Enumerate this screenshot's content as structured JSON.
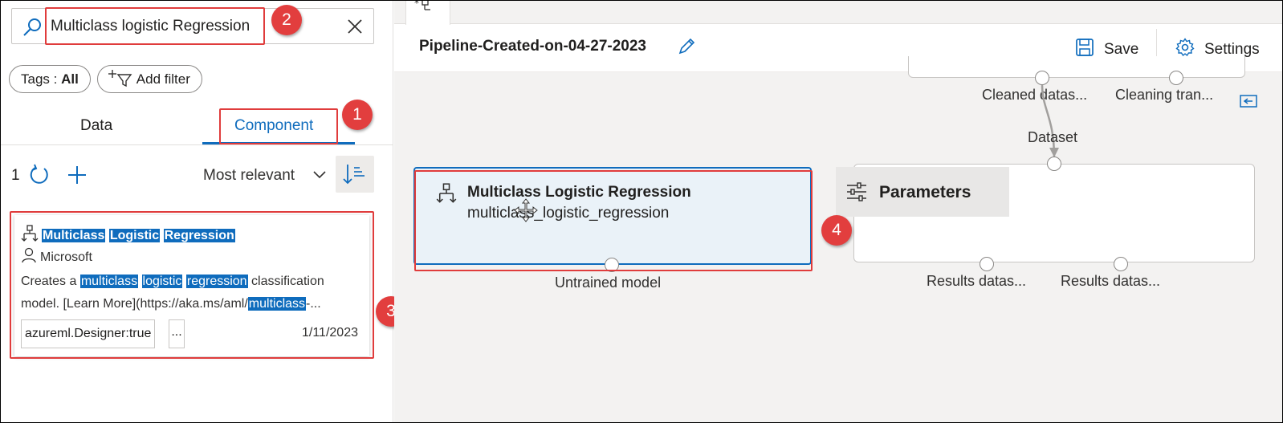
{
  "search": {
    "value": "Multiclass logistic Regression"
  },
  "filters": {
    "tags_label": "Tags : ",
    "tags_value": "All",
    "add_filter_label": "Add filter"
  },
  "tabs": [
    {
      "label": "Data"
    },
    {
      "label": "Component"
    }
  ],
  "list_toolbar": {
    "count": "1",
    "sort_label": "Most relevant"
  },
  "result_card": {
    "title_words": [
      "Multiclass",
      "Logistic",
      "Regression"
    ],
    "author": "Microsoft",
    "desc_prefix": "Creates a",
    "desc_hl_1": "multiclass",
    "desc_hl_2": "logistic",
    "desc_hl_3": "regression",
    "desc_mid": "classification model. [Learn More](https://aka.ms/aml/",
    "desc_hl_4": "multiclass",
    "desc_suffix": "-...",
    "tag": "azureml.Designer:true",
    "more": "...",
    "date": "1/11/2023"
  },
  "annotations": {
    "badge_1": "1",
    "badge_2": "2",
    "badge_3": "3",
    "badge_4": "4"
  },
  "pipeline": {
    "title": "Pipeline-Created-on-04-27-2023",
    "save_label": "Save",
    "settings_label": "Settings"
  },
  "canvas": {
    "upper_node_ports": [
      "Cleaned datas...",
      "Cleaning tran..."
    ],
    "edge_label": "Dataset",
    "mlr_node": {
      "title": "Multiclass Logistic Regression",
      "subtitle": "multiclass_logistic_regression",
      "output_port": "Untrained model"
    },
    "right_node_ports": [
      "Results datas...",
      "Results datas..."
    ],
    "parameters_label": "Parameters"
  },
  "colors": {
    "accent": "#0f6cbd",
    "annotation_red": "#e23e3e"
  }
}
